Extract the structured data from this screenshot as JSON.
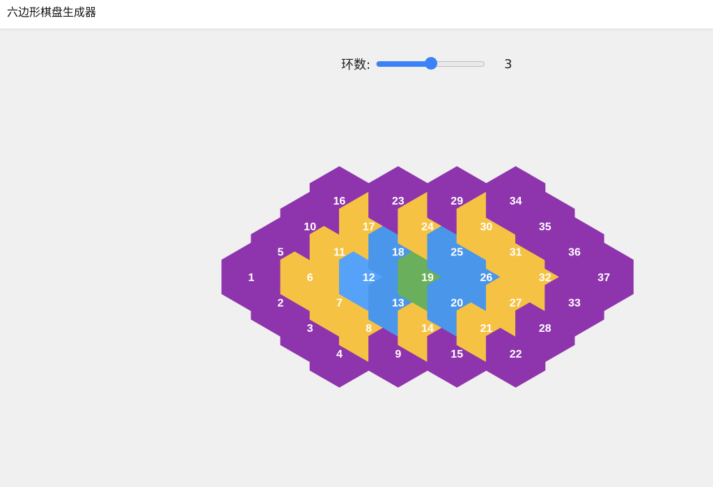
{
  "app": {
    "title": "六边形棋盘生成器"
  },
  "controls": {
    "ring_label": "环数:",
    "ring_value": "3",
    "ring_min": 1,
    "ring_max": 5,
    "ring_current": 3
  },
  "colors": {
    "ring0": "#6aaf5b",
    "ring1": "#4a96ea",
    "ring1_hover": "#55a2f8",
    "ring2": "#f6c244",
    "ring3": "#8e34ad",
    "slider": "#3b82f6"
  },
  "board": {
    "columns": [
      [
        1
      ],
      [
        2,
        5
      ],
      [
        3,
        6,
        10
      ],
      [
        4,
        7,
        11,
        16
      ],
      [
        8,
        12,
        17
      ],
      [
        9,
        13,
        18,
        23
      ],
      [
        14,
        19,
        24
      ],
      [
        15,
        20,
        25,
        29
      ],
      [
        21,
        26,
        30
      ],
      [
        22,
        27,
        31,
        34
      ],
      [
        28,
        32,
        35
      ],
      [
        33,
        36
      ],
      [
        37
      ]
    ],
    "rings": {
      "1": 3,
      "2": 3,
      "3": 3,
      "4": 3,
      "5": 3,
      "6": 2,
      "7": 2,
      "8": 2,
      "9": 3,
      "10": 3,
      "11": 2,
      "12": 1,
      "13": 1,
      "14": 2,
      "15": 3,
      "16": 3,
      "17": 2,
      "18": 1,
      "19": 0,
      "20": 1,
      "21": 2,
      "22": 3,
      "23": 3,
      "24": 2,
      "25": 1,
      "26": 1,
      "27": 2,
      "28": 3,
      "29": 3,
      "30": 2,
      "31": 2,
      "32": 2,
      "33": 3,
      "34": 3,
      "35": 3,
      "36": 3,
      "37": 3
    },
    "highlighted": [
      12
    ]
  }
}
